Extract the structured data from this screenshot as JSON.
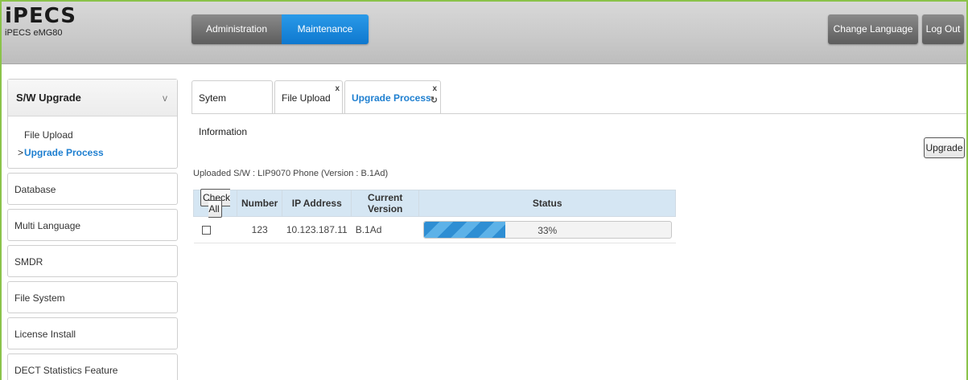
{
  "header": {
    "logo_text": "iPECS",
    "logo_sub": "iPECS eMG80",
    "nav": [
      {
        "label": "Administration"
      },
      {
        "label": "Maintenance",
        "active": true
      }
    ],
    "change_language": "Change Language",
    "logout": "Log Out"
  },
  "sidebar": {
    "group": {
      "title": "S/W Upgrade",
      "chevron": "v",
      "items": [
        {
          "label": "File Upload"
        },
        {
          "label": "Upgrade Process",
          "active": true,
          "marker": ">"
        }
      ]
    },
    "items": [
      {
        "label": "Database"
      },
      {
        "label": "Multi Language"
      },
      {
        "label": "SMDR"
      },
      {
        "label": "File System"
      },
      {
        "label": "License Install"
      },
      {
        "label": "DECT Statistics Feature"
      }
    ]
  },
  "tabs": [
    {
      "label": "Sytem Information"
    },
    {
      "label": "File Upload",
      "closable": true
    },
    {
      "label": "Upgrade Process",
      "active": true,
      "closable": true,
      "refresh": true
    }
  ],
  "icons": {
    "close": "x",
    "refresh": "↻"
  },
  "actions": {
    "upgrade": "Upgrade"
  },
  "uploaded_sw": "Uploaded S/W : LIP9070 Phone (Version : B.1Ad)",
  "table": {
    "check_all": "Check All",
    "headers": [
      "Number",
      "IP Address",
      "Current Version",
      "Status"
    ],
    "rows": [
      {
        "number": "123",
        "ip": "10.123.187.11",
        "version": "B.1Ad",
        "progress_percent": 33,
        "status_text": "33%"
      }
    ]
  },
  "colors": {
    "accent": "#1e7fd0",
    "maintenance": "#1a8ae0",
    "frame": "#8bc34a"
  }
}
